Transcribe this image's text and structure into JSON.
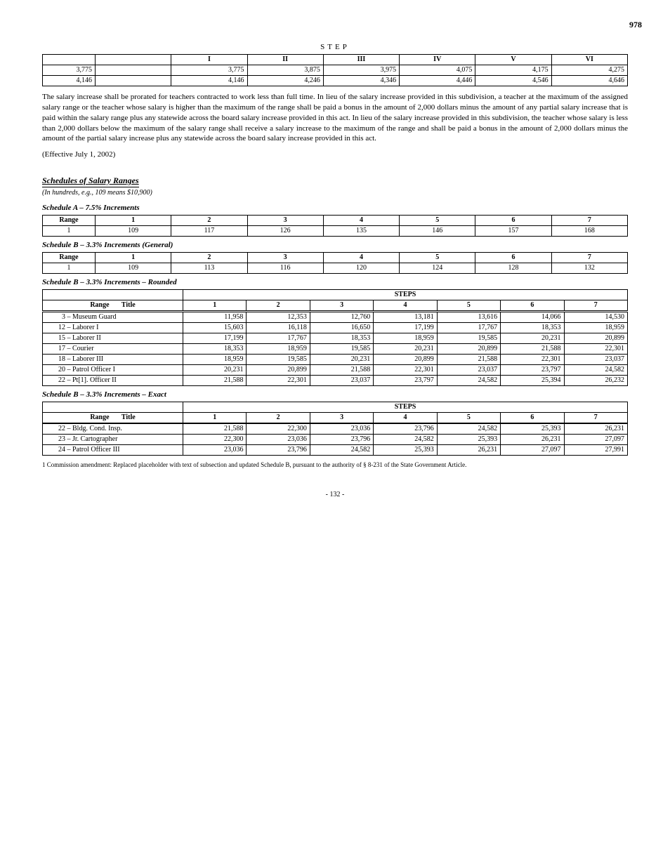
{
  "corner": "978",
  "table1": {
    "headers": [
      "",
      "",
      "I",
      "II",
      "III",
      "IV",
      "V",
      "VI"
    ],
    "r1": [
      "3,775",
      "",
      "3,775",
      "3,875",
      "3,975",
      "4,075",
      "4,175",
      "4,275"
    ],
    "r2": [
      "4,146",
      "",
      "4,146",
      "4,246",
      "4,346",
      "4,446",
      "4,546",
      "4,646"
    ]
  },
  "p1": "The salary increase shall be prorated for teachers contracted to work less than full time. In lieu of the salary increase provided in this subdivision, a teacher at the maximum of the assigned salary range or the teacher whose salary is higher than the maximum of the range shall be paid a bonus in the amount of 2,000 dollars minus the amount of any partial salary increase that is paid within the salary range plus any statewide across the board salary increase provided in this act. In lieu of the salary increase provided in this subdivision, the teacher whose salary is less than 2,000 dollars below the maximum of the salary range shall receive a salary increase to the maximum of the range and shall be paid a bonus in the amount of 2,000 dollars minus the amount of the partial salary increase plus any statewide across the board salary increase provided in this act.",
  "p2": "(Effective July 1, 2002)",
  "section": {
    "title": "Schedules of Salary Ranges",
    "sub": "(In hundreds, e.g., 109 means $10,900)"
  },
  "tableA": {
    "title": "Schedule A – 7.5% Increments",
    "headers": [
      "Range",
      "1",
      "2",
      "3",
      "4",
      "5",
      "6",
      "7"
    ],
    "r1": [
      "1",
      "109",
      "117",
      "126",
      "135",
      "146",
      "157",
      "168"
    ]
  },
  "tableB": {
    "title": "Schedule B – 3.3% Increments (General)",
    "headers": [
      "Range",
      "1",
      "2",
      "3",
      "4",
      "5",
      "6",
      "7"
    ],
    "r1": [
      "1",
      "109",
      "113",
      "116",
      "120",
      "124",
      "128",
      "132"
    ]
  },
  "tableRounded": {
    "title": "Schedule B – 3.3% Increments – Rounded",
    "mainhead": "STEPS",
    "headers": [
      "Range",
      "Title",
      "1",
      "2",
      "3",
      "4",
      "5",
      "6",
      "7"
    ],
    "rows": [
      [
        "3",
        "Museum Guard",
        "11,958",
        "12,353",
        "12,760",
        "13,181",
        "13,616",
        "14,066",
        "14,530"
      ],
      [
        "12",
        "Laborer I",
        "15,603",
        "16,118",
        "16,650",
        "17,199",
        "17,767",
        "18,353",
        "18,959"
      ],
      [
        "15",
        "Laborer II",
        "17,199",
        "17,767",
        "18,353",
        "18,959",
        "19,585",
        "20,231",
        "20,899"
      ],
      [
        "17",
        "Courier",
        "18,353",
        "18,959",
        "19,585",
        "20,231",
        "20,899",
        "21,588",
        "22,301"
      ],
      [
        "18",
        "Laborer III",
        "18,959",
        "19,585",
        "20,231",
        "20,899",
        "21,588",
        "22,301",
        "23,037"
      ],
      [
        "20",
        "Patrol Officer I",
        "20,231",
        "20,899",
        "21,588",
        "22,301",
        "23,037",
        "23,797",
        "24,582"
      ],
      [
        "22",
        "Pt[1]. Officer II",
        "21,588",
        "22,301",
        "23,037",
        "23,797",
        "24,582",
        "25,394",
        "26,232"
      ]
    ]
  },
  "tableExact": {
    "title": "Schedule B – 3.3% Increments – Exact",
    "mainhead": "STEPS",
    "headers": [
      "Range",
      "Title",
      "1",
      "2",
      "3",
      "4",
      "5",
      "6",
      "7"
    ],
    "rows": [
      [
        "22",
        "Bldg. Cond. Insp.",
        "21,588",
        "22,300",
        "23,036",
        "23,796",
        "24,582",
        "25,393",
        "26,231"
      ],
      [
        "23",
        "Jr. Cartographer",
        "22,300",
        "23,036",
        "23,796",
        "24,582",
        "25,393",
        "26,231",
        "27,097"
      ],
      [
        "24",
        "Patrol Officer III",
        "23,036",
        "23,796",
        "24,582",
        "25,393",
        "26,231",
        "27,097",
        "27,991"
      ]
    ]
  },
  "fn": "1 Commission amendment: Replaced placeholder with text of subsection and updated Schedule B, pursuant to the authority of § 8-231 of the State Government Article.",
  "page": "- 132 -"
}
